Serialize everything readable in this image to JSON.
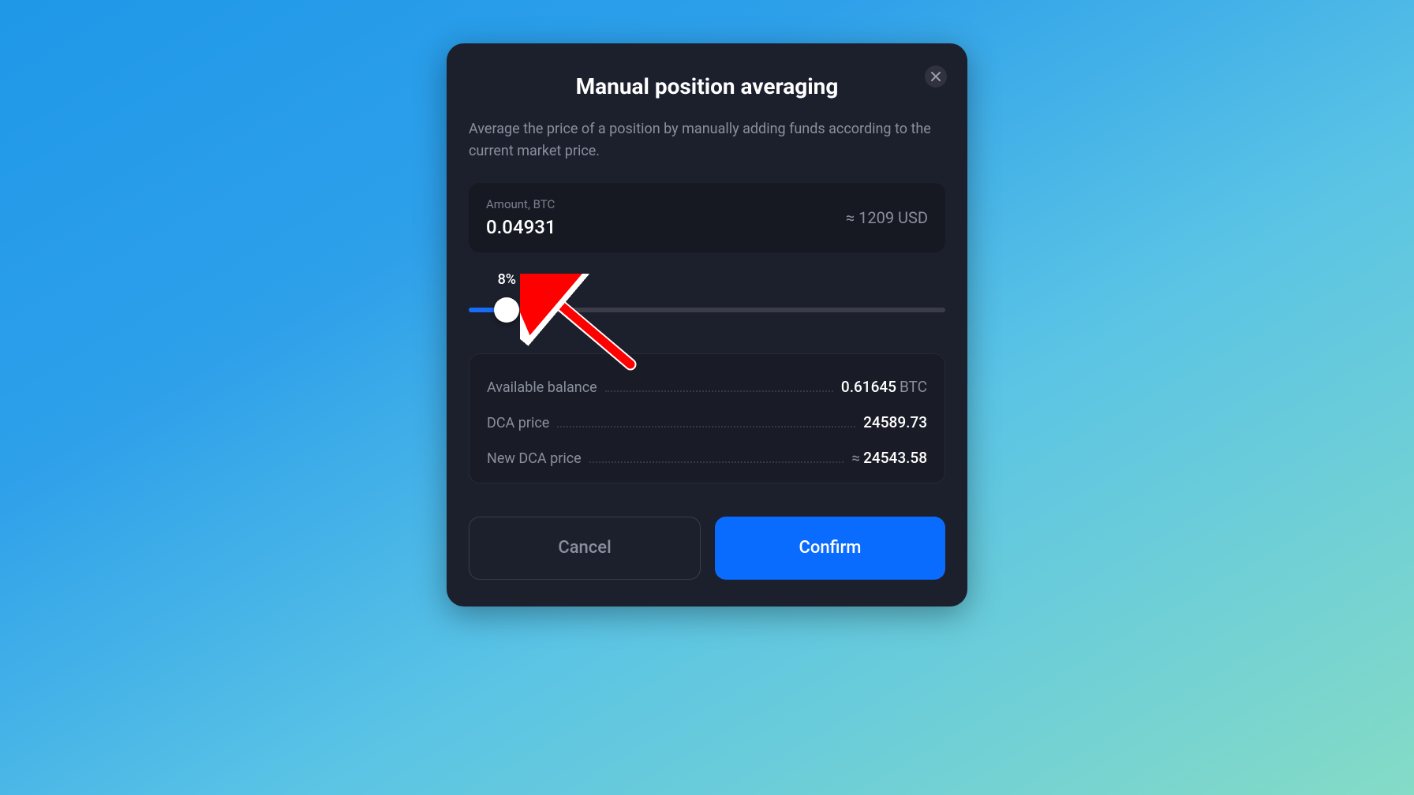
{
  "modal": {
    "title": "Manual position averaging",
    "description": "Average the price of a position by manually adding funds according to the current market price.",
    "amount": {
      "label": "Amount, BTC",
      "value": "0.04931",
      "approx": "≈ 1209 USD"
    },
    "slider": {
      "percent_label": "8%",
      "percent_value": 8
    },
    "info": {
      "available_balance_label": "Available balance",
      "available_balance_value": "0.61645",
      "available_balance_unit": "BTC",
      "dca_price_label": "DCA price",
      "dca_price_value": "24589.73",
      "new_dca_price_label": "New DCA price",
      "new_dca_price_value": "24543.58"
    },
    "buttons": {
      "cancel": "Cancel",
      "confirm": "Confirm"
    }
  }
}
